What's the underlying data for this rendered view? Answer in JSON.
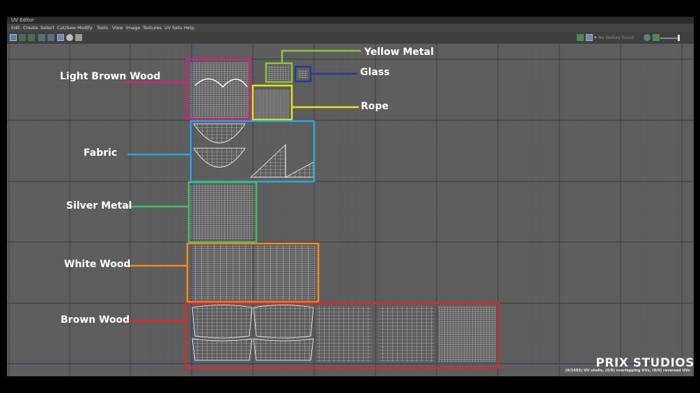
{
  "window": {
    "title": "UV Editor"
  },
  "menu": [
    "Edit",
    "Create",
    "Select",
    "Cut/Sew",
    "Modify",
    "Tools",
    "View",
    "Image",
    "Textures",
    "UV Sets",
    "Help"
  ],
  "toolbar": {
    "texture_status": "No texture found"
  },
  "labels": {
    "light_brown_wood": "Light Brown Wood",
    "fabric": "Fabric",
    "silver_metal": "Silver Metal",
    "white_wood": "White Wood",
    "brown_wood": "Brown Wood",
    "yellow_metal": "Yellow Metal",
    "glass": "Glass",
    "rope": "Rope"
  },
  "colors": {
    "light_brown_wood": "#d6207a",
    "fabric": "#2aa7df",
    "silver_metal": "#3ec06a",
    "white_wood": "#f28a1c",
    "brown_wood": "#e0262b",
    "yellow_metal": "#8cc63e",
    "glass": "#2c3799",
    "rope": "#e8e21e"
  },
  "branding": {
    "name": "PRIX STUDIOS",
    "stats": "(0/1693) UV shells, (0/0) overlapping UVs, (0/0) reversed UVs"
  }
}
